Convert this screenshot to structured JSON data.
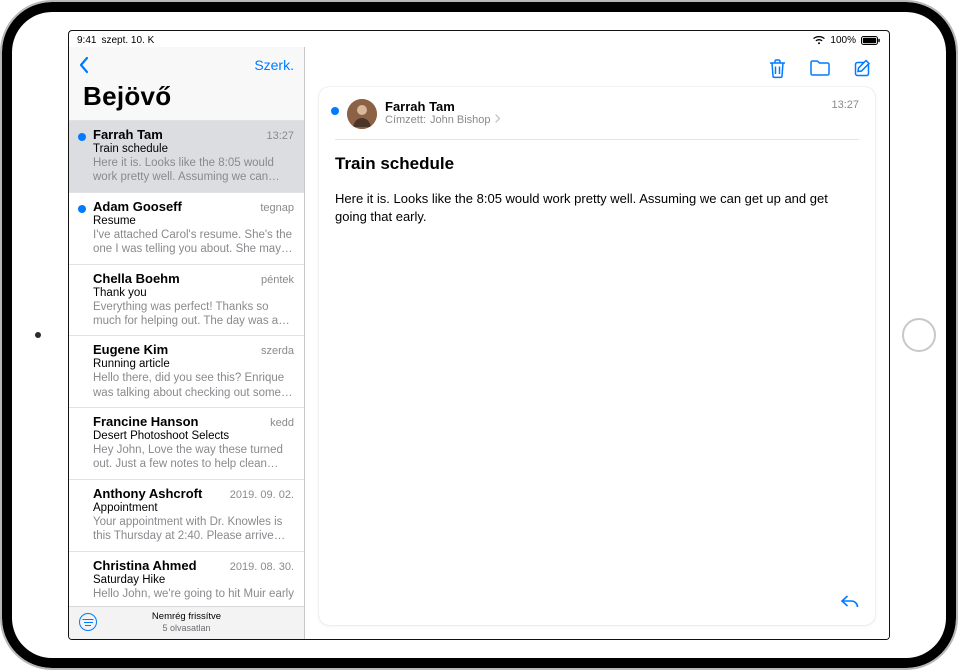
{
  "status": {
    "time": "9:41",
    "date": "szept. 10. K",
    "battery": "100%"
  },
  "sidebar": {
    "editLabel": "Szerk.",
    "title": "Bejövő",
    "footerLine1": "Nemrég frissítve",
    "footerLine2": "5 olvasatlan"
  },
  "messages": [
    {
      "from": "Farrah Tam",
      "date": "13:27",
      "subject": "Train schedule",
      "preview": "Here it is. Looks like the 8:05 would work pretty well. Assuming we can get…",
      "unread": true,
      "selected": true
    },
    {
      "from": "Adam Gooseff",
      "date": "tegnap",
      "subject": "Resume",
      "preview": "I've attached Carol's resume. She's the one I was telling you about. She may n…",
      "unread": true,
      "selected": false
    },
    {
      "from": "Chella Boehm",
      "date": "péntek",
      "subject": "Thank you",
      "preview": "Everything was perfect! Thanks so much for helping out. The day was a great su…",
      "unread": false,
      "selected": false
    },
    {
      "from": "Eugene Kim",
      "date": "szerda",
      "subject": "Running article",
      "preview": "Hello there, did you see this? Enrique was talking about checking out some o…",
      "unread": false,
      "selected": false
    },
    {
      "from": "Francine Hanson",
      "date": "kedd",
      "subject": "Desert Photoshoot Selects",
      "preview": "Hey John, Love the way these turned out. Just a few notes to help clean this…",
      "unread": false,
      "selected": false
    },
    {
      "from": "Anthony Ashcroft",
      "date": "2019. 09. 02.",
      "subject": "Appointment",
      "preview": "Your appointment with Dr. Knowles is this Thursday at 2:40. Please arrive by…",
      "unread": false,
      "selected": false
    },
    {
      "from": "Christina Ahmed",
      "date": "2019. 08. 30.",
      "subject": "Saturday Hike",
      "preview": "Hello John, we're going to hit Muir early",
      "unread": false,
      "selected": false
    }
  ],
  "detail": {
    "from": "Farrah Tam",
    "toLabel": "Címzett:",
    "to": "John Bishop",
    "time": "13:27",
    "subject": "Train schedule",
    "body": "Here it is. Looks like the 8:05 would work pretty well. Assuming we can get up and get going that early."
  }
}
